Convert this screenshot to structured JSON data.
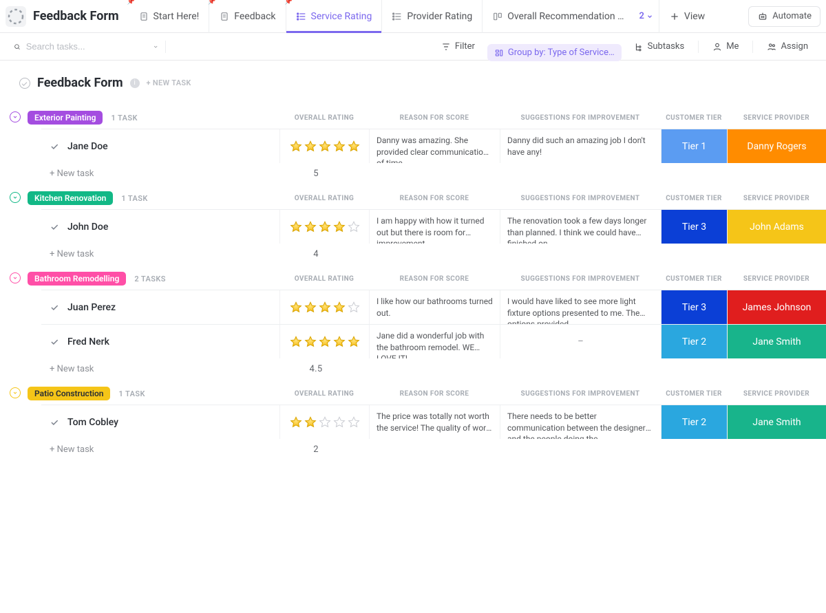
{
  "app": {
    "title": "Feedback Form"
  },
  "tabs": {
    "items": [
      {
        "label": "Start Here!"
      },
      {
        "label": "Feedback"
      },
      {
        "label": "Service Rating"
      },
      {
        "label": "Provider Rating"
      },
      {
        "label": "Overall Recommendation …"
      }
    ],
    "more_count": "2",
    "add_view": "View",
    "automate": "Automate"
  },
  "toolbar": {
    "search_placeholder": "Search tasks...",
    "filter": "Filter",
    "group_by": "Group by: Type of Service…",
    "subtasks": "Subtasks",
    "me": "Me",
    "assign": "Assign"
  },
  "page": {
    "heading": "Feedback Form",
    "new_task": "+ NEW TASK"
  },
  "columns": {
    "rating": "OVERALL RATING",
    "reason": "REASON FOR SCORE",
    "suggestions": "SUGGESTIONS FOR IMPROVEMENT",
    "tier": "CUSTOMER TIER",
    "provider": "SERVICE PROVIDER"
  },
  "labels": {
    "new_task_row": "+ New task"
  },
  "groups": [
    {
      "name": "Exterior Painting",
      "color": "purple",
      "count": "1 TASK",
      "avg": "5",
      "rows": [
        {
          "name": "Jane Doe",
          "stars": 5,
          "reason": "Danny was amazing. She provided clear communication of time…",
          "suggestions": "Danny did such an amazing job I don't have any!",
          "tier": {
            "label": "Tier 1",
            "class": "tier-1"
          },
          "provider": {
            "label": "Danny Rogers",
            "class": "prov-orange"
          }
        }
      ]
    },
    {
      "name": "Kitchen Renovation",
      "color": "teal",
      "count": "1 TASK",
      "avg": "4",
      "rows": [
        {
          "name": "John Doe",
          "stars": 4,
          "reason": "I am happy with how it turned out but there is room for improvement",
          "suggestions": "The renovation took a few days longer than planned. I think we could have finished on …",
          "tier": {
            "label": "Tier 3",
            "class": "tier-3"
          },
          "provider": {
            "label": "John Adams",
            "class": "prov-yellow"
          }
        }
      ]
    },
    {
      "name": "Bathroom Remodelling",
      "color": "pink",
      "count": "2 TASKS",
      "avg": "4.5",
      "rows": [
        {
          "name": "Juan Perez",
          "stars": 4,
          "reason": "I like how our bathrooms turned out.",
          "suggestions": "I would have liked to see more light fixture options presented to me. The options provided…",
          "tier": {
            "label": "Tier 3",
            "class": "tier-3"
          },
          "provider": {
            "label": "James Johnson",
            "class": "prov-red"
          }
        },
        {
          "name": "Fred Nerk",
          "stars": 5,
          "reason": "Jane did a wonderful job with the bathroom remodel. WE LOVE IT!",
          "suggestions": "–",
          "tier": {
            "label": "Tier 2",
            "class": "tier-2"
          },
          "provider": {
            "label": "Jane Smith",
            "class": "prov-green"
          }
        }
      ]
    },
    {
      "name": "Patio Construction",
      "color": "yellow",
      "count": "1 TASK",
      "avg": "2",
      "rows": [
        {
          "name": "Tom Cobley",
          "stars": 2,
          "reason": "The price was totally not worth the service! The quality of work …",
          "suggestions": "There needs to be better communication between the designer and the people doing the…",
          "tier": {
            "label": "Tier 2",
            "class": "tier-2"
          },
          "provider": {
            "label": "Jane Smith",
            "class": "prov-green"
          }
        }
      ]
    }
  ]
}
